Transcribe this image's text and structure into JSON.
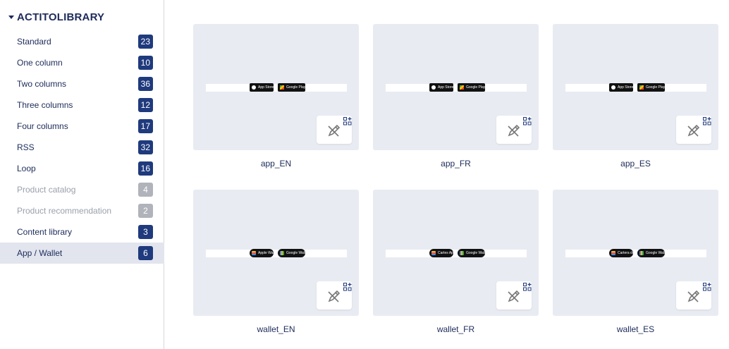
{
  "library": {
    "title": "ACTITOLIBRARY",
    "items": [
      {
        "label": "Standard",
        "count": "23",
        "state": "normal"
      },
      {
        "label": "One column",
        "count": "10",
        "state": "normal"
      },
      {
        "label": "Two columns",
        "count": "36",
        "state": "normal"
      },
      {
        "label": "Three columns",
        "count": "12",
        "state": "normal"
      },
      {
        "label": "Four columns",
        "count": "17",
        "state": "normal"
      },
      {
        "label": "RSS",
        "count": "32",
        "state": "normal"
      },
      {
        "label": "Loop",
        "count": "16",
        "state": "normal"
      },
      {
        "label": "Product catalog",
        "count": "4",
        "state": "disabled"
      },
      {
        "label": "Product recommendation",
        "count": "2",
        "state": "disabled"
      },
      {
        "label": "Content library",
        "count": "3",
        "state": "normal"
      },
      {
        "label": "App / Wallet",
        "count": "6",
        "state": "active"
      }
    ]
  },
  "templates": [
    {
      "name": "app_EN",
      "badges": [
        {
          "text": "App Store",
          "kind": "apple"
        },
        {
          "text": "Google Play",
          "kind": "play"
        }
      ]
    },
    {
      "name": "app_FR",
      "badges": [
        {
          "text": "App Store",
          "kind": "apple"
        },
        {
          "text": "Google Play",
          "kind": "play"
        }
      ]
    },
    {
      "name": "app_ES",
      "badges": [
        {
          "text": "App Store",
          "kind": "apple"
        },
        {
          "text": "Google Play",
          "kind": "play"
        }
      ]
    },
    {
      "name": "wallet_EN",
      "badges": [
        {
          "text": "Apple Wallet",
          "kind": "apple-wallet"
        },
        {
          "text": "Google Wallet",
          "kind": "wallet"
        }
      ]
    },
    {
      "name": "wallet_FR",
      "badges": [
        {
          "text": "Cartes Apple",
          "kind": "apple-wallet"
        },
        {
          "text": "Google Wallet",
          "kind": "wallet"
        }
      ]
    },
    {
      "name": "wallet_ES",
      "badges": [
        {
          "text": "Cartera de Apple",
          "kind": "apple-wallet"
        },
        {
          "text": "Google Wallet",
          "kind": "wallet"
        }
      ]
    }
  ],
  "colors": {
    "accent": "#1f3a7d",
    "active_bg": "#e2e5ee",
    "card_bg": "#e8ebf2",
    "disabled_badge": "#b0b3ba"
  }
}
